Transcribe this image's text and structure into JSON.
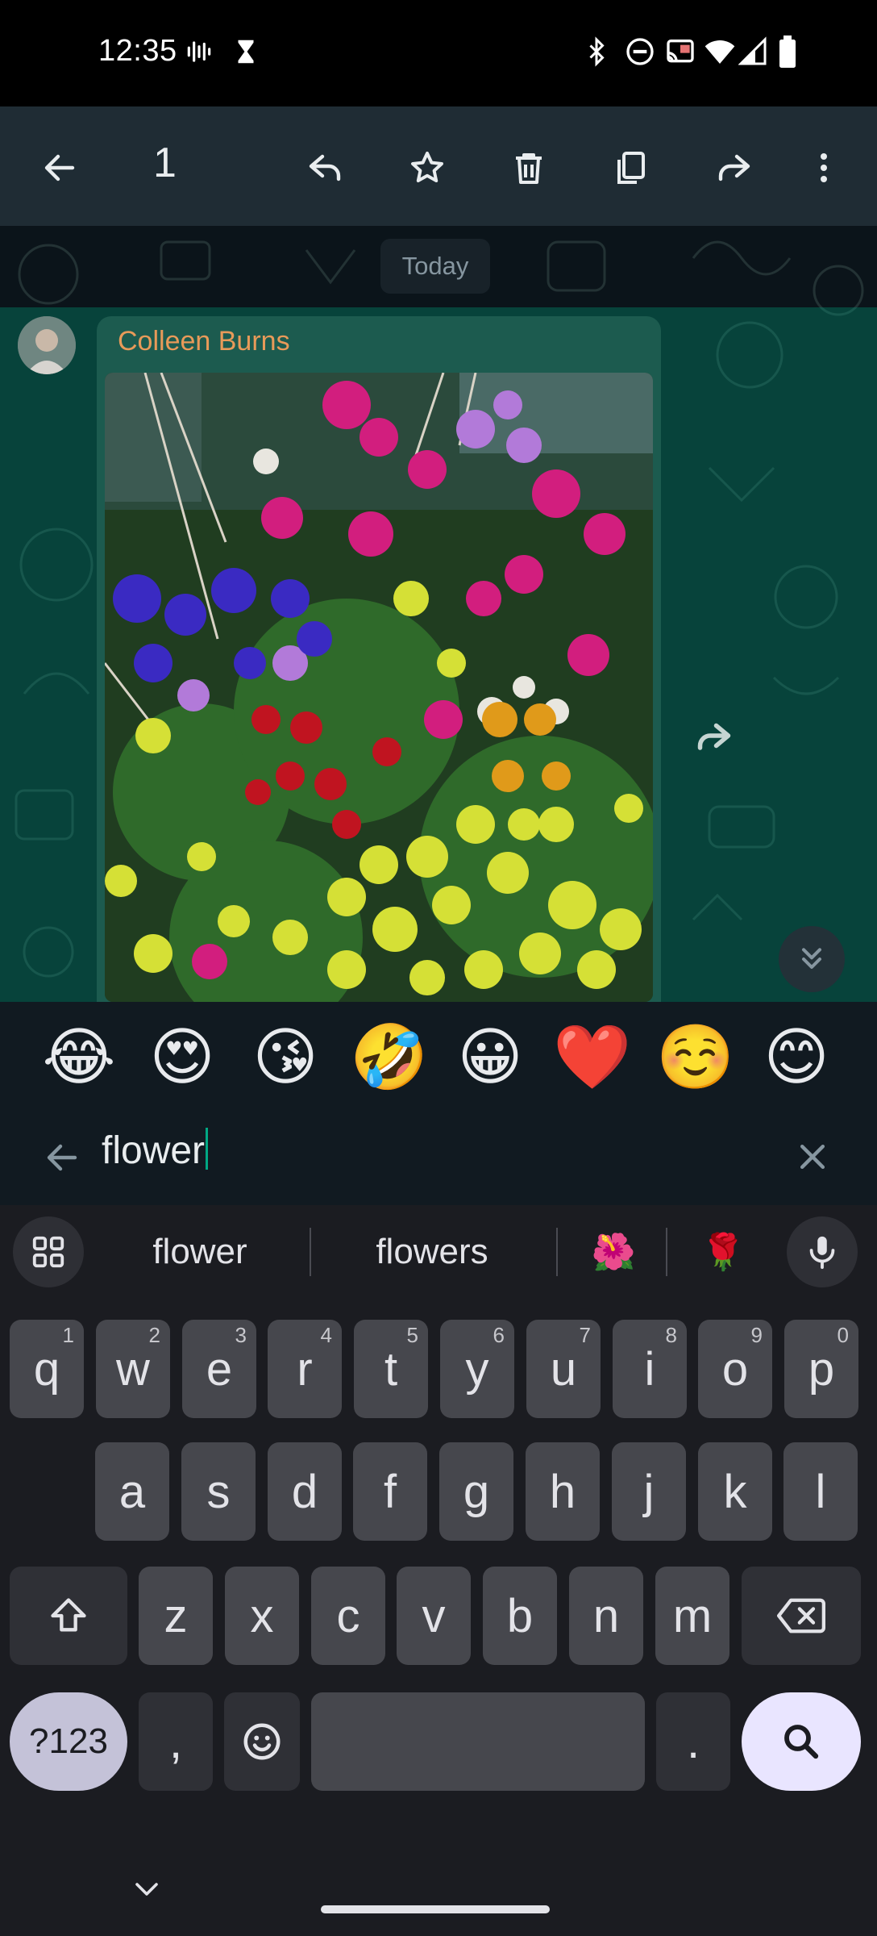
{
  "status_bar": {
    "time": "12:35",
    "left_icons": [
      "voicemail-icon",
      "hourglass-icon"
    ],
    "right_icons": [
      "bluetooth-icon",
      "do-not-disturb-icon",
      "cast-icon",
      "wifi-icon",
      "cellular-signal-icon",
      "battery-icon"
    ]
  },
  "action_bar": {
    "selected_count": "1",
    "actions": [
      "back-arrow-icon",
      "reply-icon",
      "star-icon",
      "delete-icon",
      "copy-icon",
      "forward-icon",
      "more-options-icon"
    ]
  },
  "chat": {
    "date_label": "Today",
    "message": {
      "sender": "Colleen Burns",
      "type": "image",
      "image_subject": "flowers"
    },
    "colors": {
      "sender_name": "#e89a59",
      "bubble": "#1c5b4f",
      "highlight": "#00a884"
    }
  },
  "emoji_suggestions": [
    "😂",
    "😍",
    "😘",
    "🤣",
    "😀",
    "❤️",
    "☺️",
    "😊"
  ],
  "emoji_search": {
    "query": "flower"
  },
  "keyboard": {
    "suggestions": [
      "flower",
      "flowers",
      "🌺",
      "🌹"
    ],
    "rows": [
      [
        {
          "k": "q",
          "h": "1"
        },
        {
          "k": "w",
          "h": "2"
        },
        {
          "k": "e",
          "h": "3"
        },
        {
          "k": "r",
          "h": "4"
        },
        {
          "k": "t",
          "h": "5"
        },
        {
          "k": "y",
          "h": "6"
        },
        {
          "k": "u",
          "h": "7"
        },
        {
          "k": "i",
          "h": "8"
        },
        {
          "k": "o",
          "h": "9"
        },
        {
          "k": "p",
          "h": "0"
        }
      ],
      [
        {
          "k": "a"
        },
        {
          "k": "s"
        },
        {
          "k": "d"
        },
        {
          "k": "f"
        },
        {
          "k": "g"
        },
        {
          "k": "h"
        },
        {
          "k": "j"
        },
        {
          "k": "k"
        },
        {
          "k": "l"
        }
      ],
      [
        {
          "k": "z"
        },
        {
          "k": "x"
        },
        {
          "k": "c"
        },
        {
          "k": "v"
        },
        {
          "k": "b"
        },
        {
          "k": "n"
        },
        {
          "k": "m"
        }
      ]
    ],
    "symbols_label": "?123",
    "comma_label": ",",
    "period_label": "."
  }
}
